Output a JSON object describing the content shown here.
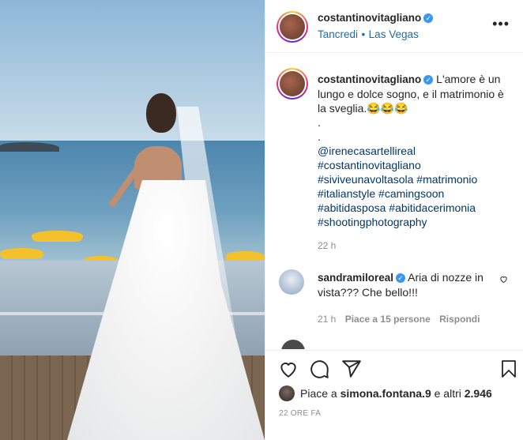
{
  "header": {
    "username": "costantinovitagliano",
    "location_sub": "Tancredi",
    "separator": "•",
    "location": "Las Vegas",
    "more_label": "•••"
  },
  "caption": {
    "username": "costantinovitagliano",
    "text": "L'amore è un lungo e dolce sogno, e il matrimonio è la sveglia.😂😂😂",
    "dot1": ".",
    "dot2": ".",
    "mention": "@irenecasartellireal",
    "tags": [
      "#costantinovitagliano",
      "#siviveunavoltasola #matrimonio",
      "#italianstyle #camingsoon",
      "#abitidasposa #abitidacerimonia",
      "#shootingphotography"
    ],
    "time": "22 h"
  },
  "comment": {
    "username": "sandramiloreal",
    "text": "Aria di nozze in vista??? Che bello!!!",
    "time": "21 h",
    "likes": "Piace a 15 persone",
    "reply": "Rispondi"
  },
  "likes": {
    "prefix": "Piace a",
    "user": "simona.fontana.9",
    "middle": "e altri",
    "count": "2.946"
  },
  "date": "22 ORE FA",
  "colors": {
    "link": "#00376b",
    "verified": "#3897f0",
    "location": "#1e6aa8",
    "muted": "#8e8e8e"
  }
}
